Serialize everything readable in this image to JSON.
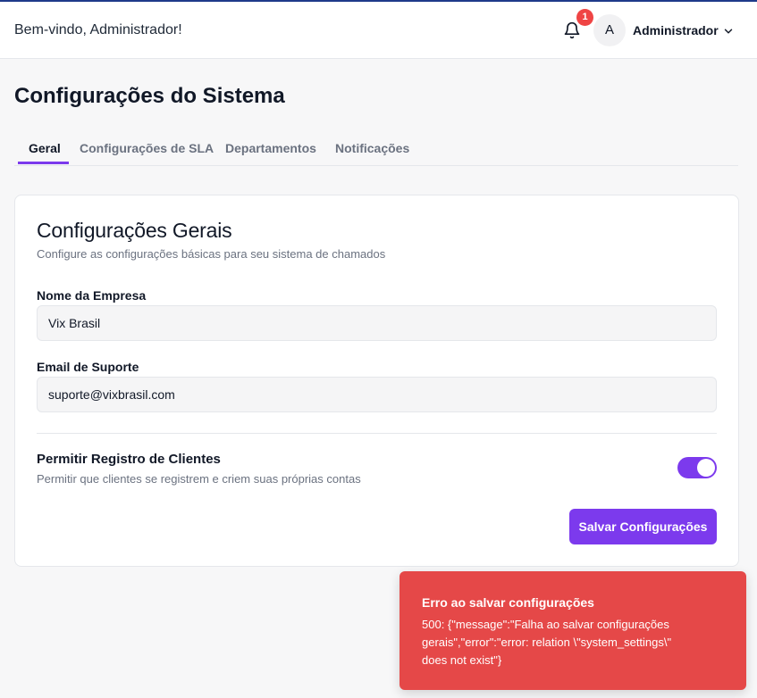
{
  "header": {
    "welcome": "Bem-vindo, Administrador!",
    "notification_count": "1",
    "avatar_initial": "A",
    "user_name": "Administrador"
  },
  "page": {
    "title": "Configurações do Sistema"
  },
  "tabs": [
    {
      "label": "Geral",
      "active": true
    },
    {
      "label": "Configurações de SLA",
      "active": false
    },
    {
      "label": "Departamentos",
      "active": false
    },
    {
      "label": "Notificações",
      "active": false
    }
  ],
  "card": {
    "title": "Configurações Gerais",
    "subtitle": "Configure as configurações básicas para seu sistema de chamados",
    "company_label": "Nome da Empresa",
    "company_value": "Vix Brasil",
    "email_label": "Email de Suporte",
    "email_value": "suporte@vixbrasil.com",
    "allow_registration_title": "Permitir Registro de Clientes",
    "allow_registration_desc": "Permitir que clientes se registrem e criem suas próprias contas",
    "allow_registration_enabled": true,
    "save_label": "Salvar Configurações"
  },
  "toast": {
    "title": "Erro ao salvar configurações",
    "message": "500: {\"message\":\"Falha ao salvar configurações gerais\",\"error\":\"error: relation \\\"system_settings\\\" does not exist\"}"
  },
  "colors": {
    "accent": "#7c3aed",
    "error": "#e54848",
    "badge": "#ef4444"
  }
}
